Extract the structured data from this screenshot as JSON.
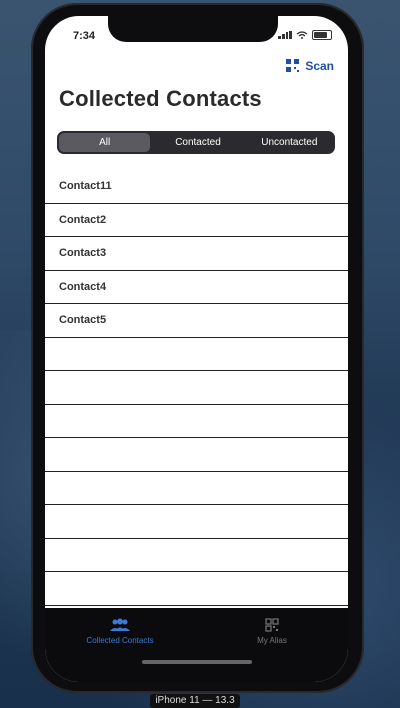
{
  "status": {
    "time": "7:34"
  },
  "header": {
    "scan_label": "Scan",
    "title": "Collected Contacts"
  },
  "segments": [
    {
      "label": "All",
      "active": true
    },
    {
      "label": "Contacted",
      "active": false
    },
    {
      "label": "Uncontacted",
      "active": false
    }
  ],
  "contacts": [
    {
      "label": "Contact11"
    },
    {
      "label": "Contact2"
    },
    {
      "label": "Contact3"
    },
    {
      "label": "Contact4"
    },
    {
      "label": "Contact5"
    },
    {
      "label": ""
    },
    {
      "label": ""
    },
    {
      "label": ""
    },
    {
      "label": ""
    },
    {
      "label": ""
    },
    {
      "label": ""
    },
    {
      "label": ""
    },
    {
      "label": ""
    },
    {
      "label": ""
    }
  ],
  "tabbar": {
    "tabs": [
      {
        "label": "Collected Contacts",
        "icon": "people-icon",
        "active": true
      },
      {
        "label": "My Alias",
        "icon": "qr-icon",
        "active": false
      }
    ]
  },
  "device": {
    "label": "iPhone 11 — 13.3"
  },
  "colors": {
    "accent": "#1e4fa8",
    "tab_active": "#3a7bd5",
    "tab_inactive": "#777777"
  }
}
